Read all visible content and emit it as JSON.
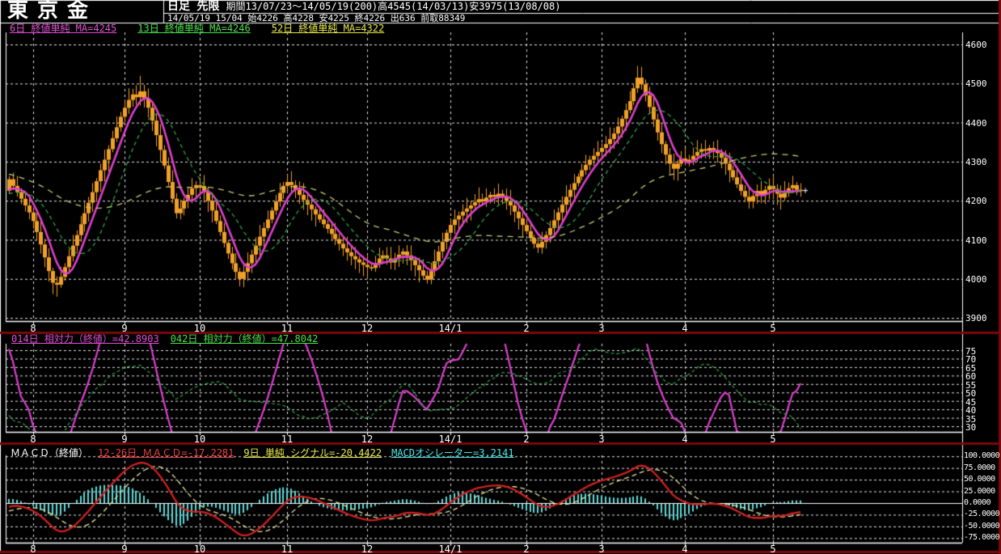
{
  "window": {
    "title": "東京金",
    "header": {
      "timeframe": "日足 先限",
      "period": "期間13/07/23～14/05/19(200)高4545(14/03/13)安3975(13/08/08)",
      "quote": "14/05/19 15/04 始4226 高4228 安4225 終4226 出636 前取88349"
    }
  },
  "ma_legend": {
    "ma6": "6日 終値単純 MA=4245",
    "ma13": "13日 終値単純 MA=4246",
    "ma52": "52日 終値単純 MA=4322"
  },
  "rsi_legend": {
    "rsi14": "014日 相対力（終値）=42.8903",
    "rsi42": "042日 相対力（終値）=47.8042"
  },
  "macd_legend": {
    "title": "ＭＡＣＤ（終値）",
    "macd": "12-26日 ＭＡＣＤ=-17.2281",
    "signal": "9日 単純 シグナル=-20.4422",
    "osc": "MACDオシレーター=3.2141"
  },
  "colors": {
    "background": "#000000",
    "frame": "#ffffff",
    "grid": "#e6e6e6",
    "separator": "#7a0a0a",
    "candle": "#f0a028",
    "ma6": "#dd3fd0",
    "ma13": "#2fa44a",
    "ma52": "#c9c96e",
    "rsi14": "#dd3fd0",
    "rsi42": "#2fa44a",
    "macd_line": "#d02020",
    "macd_signal": "#e8e89a",
    "macd_hist": "#5ed9d9"
  },
  "chart_data": [
    {
      "type": "candlestick",
      "title": "東京金 日足 先限",
      "x_tick_labels": [
        "8",
        "9",
        "10",
        "11",
        "12",
        "14/1",
        "2",
        "3",
        "4",
        "5"
      ],
      "x_tick_indices": [
        6,
        29,
        48,
        70,
        90,
        111,
        130,
        149,
        170,
        192
      ],
      "y_ticks": [
        4600,
        4500,
        4400,
        4300,
        4200,
        4100,
        4000,
        3900
      ],
      "ylim": [
        3880,
        4620
      ],
      "period_high": {
        "value": 4545,
        "date": "14/03/13"
      },
      "period_low": {
        "value": 3975,
        "date": "13/08/08"
      },
      "last": {
        "date": "14/05/19",
        "open": 4226,
        "high": 4228,
        "low": 4225,
        "close": 4226,
        "volume": 636,
        "open_interest": 88349
      },
      "ma": [
        {
          "period": 6,
          "type": "終値単純",
          "last": 4245,
          "color": "#dd3fd0",
          "style": "solid"
        },
        {
          "period": 13,
          "type": "終値単純",
          "last": 4246,
          "color": "#2fa44a",
          "style": "dashed"
        },
        {
          "period": 52,
          "type": "終値単純",
          "last": 4322,
          "color": "#c9c96e",
          "style": "dashed"
        }
      ],
      "closes": [
        4255,
        4238,
        4222,
        4205,
        4188,
        4170,
        4148,
        4120,
        4088,
        4055,
        4020,
        3990,
        3985,
        4005,
        4030,
        4058,
        4085,
        4112,
        4140,
        4168,
        4195,
        4222,
        4250,
        4278,
        4305,
        4332,
        4360,
        4388,
        4415,
        4438,
        4458,
        4472,
        4465,
        4480,
        4462,
        4438,
        4405,
        4368,
        4330,
        4290,
        4248,
        4205,
        4168,
        4180,
        4200,
        4215,
        4232,
        4240,
        4238,
        4222,
        4200,
        4175,
        4148,
        4120,
        4092,
        4065,
        4040,
        4018,
        4000,
        4018,
        4040,
        4062,
        4085,
        4108,
        4130,
        4152,
        4175,
        4198,
        4220,
        4238,
        4248,
        4240,
        4228,
        4215,
        4202,
        4190,
        4178,
        4165,
        4152,
        4140,
        4128,
        4115,
        4102,
        4090,
        4078,
        4068,
        4058,
        4050,
        4042,
        4036,
        4030,
        4028,
        4040,
        4052,
        4060,
        4052,
        4042,
        4052,
        4062,
        4070,
        4060,
        4048,
        4035,
        4022,
        4008,
        3998,
        4020,
        4045,
        4070,
        4095,
        4118,
        4138,
        4152,
        4162,
        4172,
        4180,
        4188,
        4196,
        4204,
        4198,
        4208,
        4215,
        4210,
        4218,
        4212,
        4200,
        4188,
        4172,
        4155,
        4138,
        4122,
        4105,
        4090,
        4080,
        4095,
        4112,
        4130,
        4150,
        4170,
        4190,
        4210,
        4228,
        4245,
        4262,
        4278,
        4292,
        4305,
        4315,
        4325,
        4335,
        4345,
        4358,
        4372,
        4390,
        4410,
        4432,
        4455,
        4488,
        4515,
        4498,
        4470,
        4440,
        4408,
        4375,
        4345,
        4318,
        4295,
        4282,
        4295,
        4308,
        4300,
        4305,
        4315,
        4325,
        4332,
        4328,
        4335,
        4330,
        4322,
        4310,
        4295,
        4278,
        4260,
        4242,
        4225,
        4210,
        4198,
        4212,
        4225,
        4215,
        4228,
        4238,
        4230,
        4218,
        4208,
        4220,
        4232,
        4240,
        4228,
        4226
      ],
      "wick_extremes": {
        "12": {
          "low": 3975
        },
        "33": {
          "high": 4520
        },
        "58": {
          "low": 3988
        },
        "105": {
          "low": 3990
        },
        "158": {
          "high": 4545
        },
        "167": {
          "low": 4270
        },
        "186": {
          "low": 4180
        }
      }
    },
    {
      "type": "line",
      "indicator": "相対力 (RSI)",
      "series": [
        {
          "period": 14,
          "source": "終値",
          "last": 42.8903,
          "color": "#dd3fd0",
          "style": "solid"
        },
        {
          "period": 42,
          "source": "終値",
          "last": 47.8042,
          "color": "#2fa44a",
          "style": "dashed"
        }
      ],
      "y_ticks": [
        75,
        70,
        65,
        60,
        55,
        50,
        45,
        40,
        35,
        30
      ],
      "ylim": [
        28,
        77
      ],
      "x_tick_labels": [
        "8",
        "9",
        "10",
        "11",
        "12",
        "14/1",
        "2",
        "3",
        "4",
        "5"
      ],
      "x_tick_indices": [
        6,
        29,
        48,
        70,
        90,
        111,
        130,
        149,
        170,
        192
      ]
    },
    {
      "type": "macd",
      "indicator": "ＭＡＣＤ（終値）",
      "params": {
        "fast": 12,
        "slow": 26,
        "signal": 9,
        "signal_type": "単純"
      },
      "last": {
        "macd": -17.2281,
        "signal": -20.4422,
        "oscillator": 3.2141
      },
      "y_tick_labels": [
        "100.0000",
        "75.0000",
        "50.0000",
        "25.0000",
        "0.0000",
        "-25.0000",
        "-50.0000",
        "-75.0000"
      ],
      "y_tick_values": [
        100,
        75,
        50,
        25,
        0,
        -25,
        -50,
        -75
      ],
      "ylim": [
        -95,
        105
      ],
      "x_tick_labels": [
        "8",
        "9",
        "10",
        "11",
        "12",
        "14/1",
        "2",
        "3",
        "4",
        "5"
      ],
      "x_tick_indices": [
        6,
        29,
        48,
        70,
        90,
        111,
        130,
        149,
        170,
        192
      ]
    }
  ]
}
